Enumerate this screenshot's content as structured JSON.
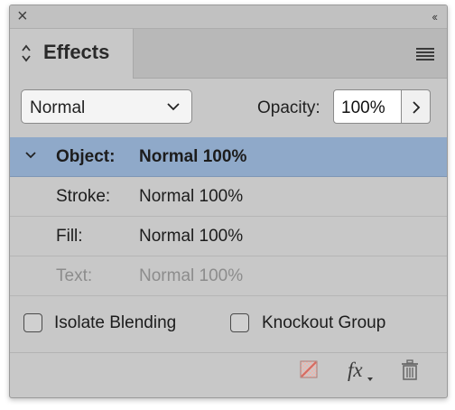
{
  "panel": {
    "tab_title": "Effects",
    "blend_mode": "Normal",
    "opacity_label": "Opacity:",
    "opacity_value": "100%",
    "rows": [
      {
        "label": "Object:",
        "value": "Normal 100%",
        "selected": true
      },
      {
        "label": "Stroke:",
        "value": "Normal 100%"
      },
      {
        "label": "Fill:",
        "value": "Normal 100%"
      },
      {
        "label": "Text:",
        "value": "Normal 100%",
        "disabled": true
      }
    ],
    "isolate_blending_label": "Isolate Blending",
    "isolate_blending_checked": false,
    "knockout_group_label": "Knockout Group",
    "knockout_group_checked": false,
    "footer_icons": [
      "clear-effects-icon",
      "fx-icon",
      "trash-icon"
    ]
  }
}
